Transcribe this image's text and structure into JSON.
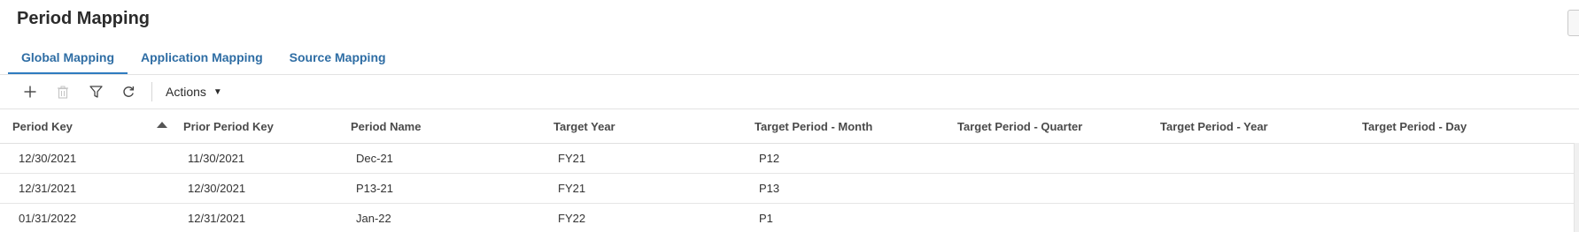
{
  "page": {
    "title": "Period Mapping"
  },
  "tabs": [
    {
      "label": "Global Mapping",
      "active": true
    },
    {
      "label": "Application Mapping",
      "active": false
    },
    {
      "label": "Source Mapping",
      "active": false
    }
  ],
  "toolbar": {
    "icons": [
      "add-icon",
      "delete-icon",
      "filter-icon",
      "refresh-icon"
    ],
    "actions_label": "Actions",
    "actions_caret": "▼"
  },
  "grid": {
    "columns": [
      "Period Key",
      "Prior Period Key",
      "Period Name",
      "Target Year",
      "Target Period - Month",
      "Target Period - Quarter",
      "Target Period - Year",
      "Target Period - Day"
    ],
    "sorted_column": "Period Key",
    "rows": [
      [
        "12/30/2021",
        "11/30/2021",
        "Dec-21",
        "FY21",
        "P12",
        "",
        "",
        ""
      ],
      [
        "12/31/2021",
        "12/30/2021",
        "P13-21",
        "FY21",
        "P13",
        "",
        "",
        ""
      ],
      [
        "01/31/2022",
        "12/31/2021",
        "Jan-22",
        "FY22",
        "P1",
        "",
        "",
        ""
      ]
    ]
  },
  "colors": {
    "accent": "#2e7bbf",
    "tab_text": "#2e6da4",
    "border": "#e3e3e3"
  }
}
